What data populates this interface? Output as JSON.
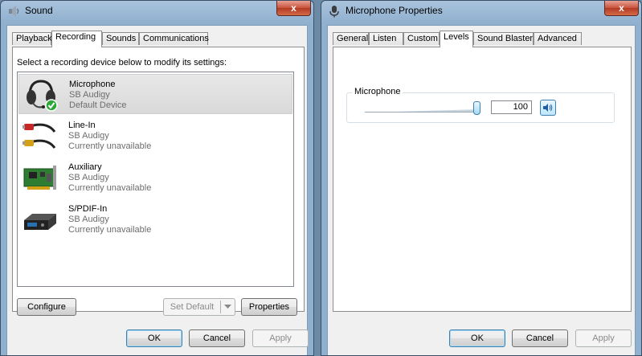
{
  "sound_window": {
    "title": "Sound",
    "close_glyph": "x",
    "tabs": [
      "Playback",
      "Recording",
      "Sounds",
      "Communications"
    ],
    "active_tab": "Recording",
    "instruction": "Select a recording device below to modify its settings:",
    "devices": [
      {
        "name": "Microphone",
        "line2": "SB Audigy",
        "line3": "Default Device",
        "icon": "headset-microphone-icon",
        "selected": true
      },
      {
        "name": "Line-In",
        "line2": "SB Audigy",
        "line3": "Currently unavailable",
        "icon": "rca-cable-icon",
        "selected": false
      },
      {
        "name": "Auxiliary",
        "line2": "SB Audigy",
        "line3": "Currently unavailable",
        "icon": "sound-card-icon",
        "selected": false
      },
      {
        "name": "S/PDIF-In",
        "line2": "SB Audigy",
        "line3": "Currently unavailable",
        "icon": "spdif-device-icon",
        "selected": false
      }
    ],
    "buttons": {
      "configure": "Configure",
      "set_default": "Set Default",
      "properties": "Properties",
      "ok": "OK",
      "cancel": "Cancel",
      "apply": "Apply"
    }
  },
  "mic_properties_window": {
    "title": "Microphone Properties",
    "close_glyph": "x",
    "tabs": [
      "General",
      "Listen",
      "Custom",
      "Levels",
      "Sound Blaster",
      "Advanced"
    ],
    "active_tab": "Levels",
    "levels": {
      "group_label": "Microphone",
      "level_value": "100",
      "slider_fraction": 1.0
    },
    "buttons": {
      "ok": "OK",
      "cancel": "Cancel",
      "apply": "Apply"
    }
  },
  "colors": {
    "title_gradient_top": "#a9c3dc",
    "close_red": "#c8523d",
    "default_check_green": "#2ea836",
    "focus_blue": "#3c7fb1"
  }
}
